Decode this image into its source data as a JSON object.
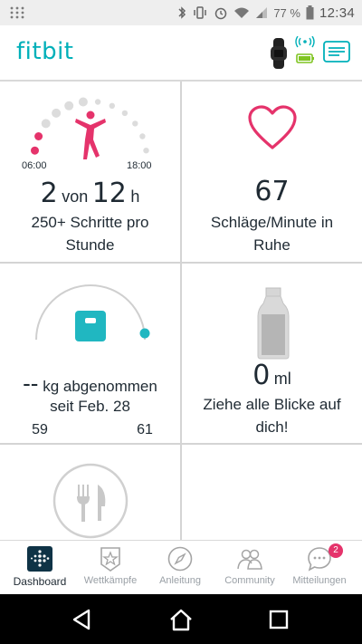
{
  "status_bar": {
    "battery_percent": "77 %",
    "time": "12:34",
    "icons": [
      "app-notification-icon",
      "bluetooth-icon",
      "vibrate-icon",
      "alarm-icon",
      "wifi-icon",
      "signal-icon",
      "battery-icon"
    ]
  },
  "header": {
    "logo": "fitbit",
    "icons": [
      "tracker-device-icon",
      "sync-status-icon",
      "profile-card-icon"
    ]
  },
  "tiles": {
    "hourly_activity": {
      "start_label": "06:00",
      "end_label": "18:00",
      "value": "2",
      "von": "von",
      "goal": "12",
      "unit": "h",
      "caption_line1": "250+ Schritte pro",
      "caption_line2": "Stunde",
      "hours_met": 2,
      "hours_goal": 12
    },
    "heart_rate": {
      "value": "67",
      "caption_line1": "Schläge/Minute in",
      "caption_line2": "Ruhe"
    },
    "weight": {
      "min_label": "59",
      "max_label": "61",
      "value": "--",
      "caption_after": "kg abgenommen",
      "caption_line2": "seit Feb. 28"
    },
    "water": {
      "value": "0",
      "unit": "ml",
      "caption_line1": "Ziehe alle Blicke auf",
      "caption_line2": "dich!"
    },
    "food": {}
  },
  "bottom_nav": {
    "items": [
      {
        "label": "Dashboard",
        "icon": "dashboard-icon",
        "active": true
      },
      {
        "label": "Wettkämpfe",
        "icon": "challenges-star-icon",
        "active": false
      },
      {
        "label": "Anleitung",
        "icon": "guidance-compass-icon",
        "active": false
      },
      {
        "label": "Community",
        "icon": "community-people-icon",
        "active": false
      },
      {
        "label": "Mitteilungen",
        "icon": "messages-bubble-icon",
        "active": false,
        "badge": "2"
      }
    ]
  },
  "colors": {
    "brand_teal": "#00b0b9",
    "pink": "#e5336b",
    "divider": "#d4d4d4"
  }
}
